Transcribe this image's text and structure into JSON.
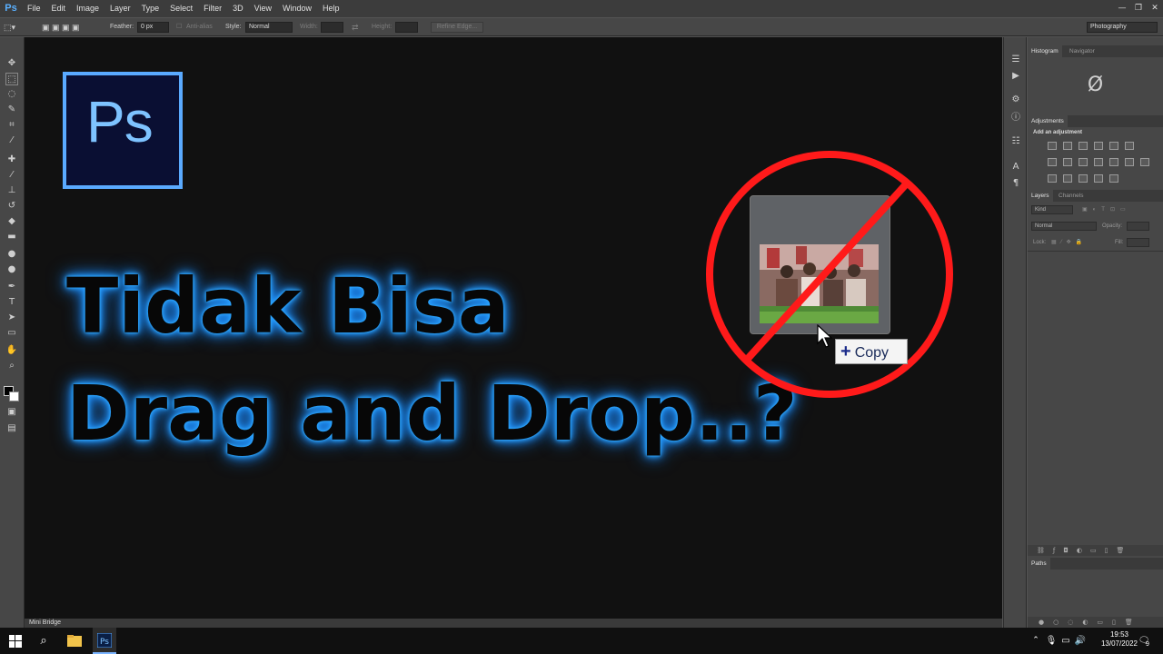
{
  "app": {
    "logo": "Ps"
  },
  "menu": [
    "File",
    "Edit",
    "Image",
    "Layer",
    "Type",
    "Select",
    "Filter",
    "3D",
    "View",
    "Window",
    "Help"
  ],
  "window_controls": {
    "minimize": "—",
    "restore": "❐",
    "close": "✕"
  },
  "options": {
    "feather_label": "Feather:",
    "feather_value": "0 px",
    "antialias_label": "Anti-alias",
    "style_label": "Style:",
    "style_value": "Normal",
    "width_label": "Width:",
    "height_label": "Height:",
    "refine_label": "Refine Edge...",
    "workspace_value": "Photography"
  },
  "canvas": {
    "logo_text": "Ps",
    "headline_1": "Tidak Bisa",
    "headline_2": "Drag and Drop..?",
    "copy_plus": "+",
    "copy_text": "Copy"
  },
  "panels": {
    "histogram_tab": "Histogram",
    "navigator_tab": "Navigator",
    "histogram_symbol": "Ø",
    "adjustments_tab": "Adjustments",
    "add_adjustment": "Add an adjustment",
    "layers_tab": "Layers",
    "channels_tab": "Channels",
    "kind_label": "Kind",
    "blend_mode": "Normal",
    "opacity_label": "Opacity:",
    "lock_label": "Lock:",
    "fill_label": "Fill:",
    "paths_tab": "Paths"
  },
  "bottom": {
    "mini_bridge": "Mini Bridge"
  },
  "taskbar": {
    "time": "19:53",
    "date": "13/07/2022",
    "notifications": "9"
  },
  "colors": {
    "accent_glow": "#2ea8ff",
    "no_sign": "#ff1a1a",
    "canvas_bg": "#111111"
  }
}
